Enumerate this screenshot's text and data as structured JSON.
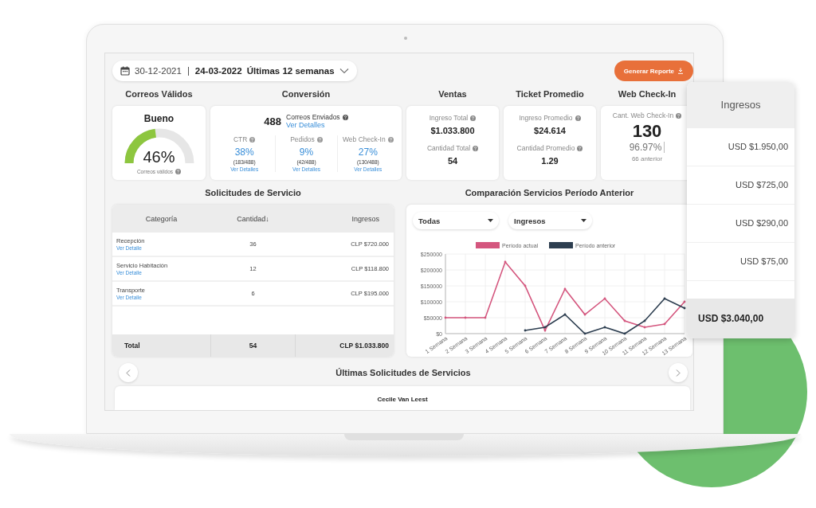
{
  "date_range": {
    "start": "30-12-2021",
    "end": "24-03-2022",
    "period": "Últimas 12 semanas"
  },
  "report_button": "Generar Reporte",
  "metrics": [
    {
      "kind": "gauge",
      "title": "Correos Válidos",
      "label": "Bueno",
      "value": "46%",
      "caption": "Correos válidos",
      "level": 0.46
    },
    {
      "kind": "conversion",
      "title": "Conversión",
      "total": "488",
      "total_label": "Correos Enviados",
      "link": "Ver Detalles",
      "items": [
        {
          "label": "CTR",
          "value": "38%",
          "detail": "(183/488)",
          "link": "Ver Detalles"
        },
        {
          "label": "Pedidos",
          "value": "9%",
          "detail": "(42/488)",
          "link": "Ver Detalles"
        },
        {
          "label": "Web Check-In",
          "value": "27%",
          "detail": "(130/488)",
          "link": "Ver Detalles"
        }
      ]
    },
    {
      "kind": "pair",
      "title": "Ventas",
      "items": [
        {
          "label": "Ingreso Total",
          "value": "$1.033.800"
        },
        {
          "label": "Cantidad Total",
          "value": "54"
        }
      ]
    },
    {
      "kind": "pair",
      "title": "Ticket Promedio",
      "items": [
        {
          "label": "Ingreso Promedio",
          "value": "$24.614"
        },
        {
          "label": "Cantidad Promedio",
          "value": "1.29"
        }
      ]
    },
    {
      "kind": "checkin",
      "title": "Web Check-In",
      "label": "Cant. Web Check-In",
      "value": "130",
      "percent": "96.97%",
      "previous": "66 anterior"
    }
  ],
  "services": {
    "title": "Solicitudes de Servicio",
    "columns": [
      "Categoría",
      "Cantidad↓",
      "Ingresos"
    ],
    "rows": [
      {
        "category": "Recepción",
        "link": "Ver Detalle",
        "quantity": "36",
        "income": "CLP $720.000"
      },
      {
        "category": "Servicio Habitación",
        "link": "Ver Detalle",
        "quantity": "12",
        "income": "CLP $118.800"
      },
      {
        "category": "Transporte",
        "link": "Ver Detalle",
        "quantity": "6",
        "income": "CLP $195.000"
      }
    ],
    "total": [
      "Total",
      "54",
      "CLP $1.033.800"
    ]
  },
  "comparison": {
    "title": "Comparación Servicios Período Anterior",
    "filters": [
      "Todas",
      "Ingresos"
    ],
    "chart_data": {
      "type": "line",
      "categories": [
        "1 Semana",
        "2 Semana",
        "3 Semana",
        "4 Semana",
        "5 Semana",
        "6 Semana",
        "7 Semana",
        "8 Semana",
        "9 Semana",
        "10 Semana",
        "11 Semana",
        "12 Semana",
        "13 Semana"
      ],
      "series": [
        {
          "name": "Período actual",
          "color": "#d4567e",
          "values": [
            50000,
            50000,
            50000,
            225000,
            150000,
            10000,
            140000,
            60000,
            110000,
            40000,
            20000,
            30000,
            100000
          ]
        },
        {
          "name": "Período anterior",
          "color": "#2d3e50",
          "values": [
            null,
            null,
            null,
            null,
            10000,
            20000,
            60000,
            0,
            20000,
            0,
            40000,
            110000,
            80000
          ]
        }
      ],
      "ylim": [
        0,
        250000
      ],
      "grid": true,
      "legend": true,
      "yticks": [
        {
          "value": 0,
          "label": "$0"
        },
        {
          "value": 50000,
          "label": "$50000"
        },
        {
          "value": 100000,
          "label": "$100000"
        },
        {
          "value": 150000,
          "label": "$150000"
        },
        {
          "value": 200000,
          "label": "$200000"
        },
        {
          "value": 250000,
          "label": "$250000"
        }
      ]
    }
  },
  "latest": {
    "title": "Últimas Solicitudes de Servicios",
    "first_name": "Cecile Van Leest"
  },
  "income_panel": {
    "header": "Ingresos",
    "rows": [
      "USD $1.950,00",
      "USD $725,00",
      "USD $290,00",
      "USD $75,00"
    ],
    "total": "USD $3.040,00"
  }
}
